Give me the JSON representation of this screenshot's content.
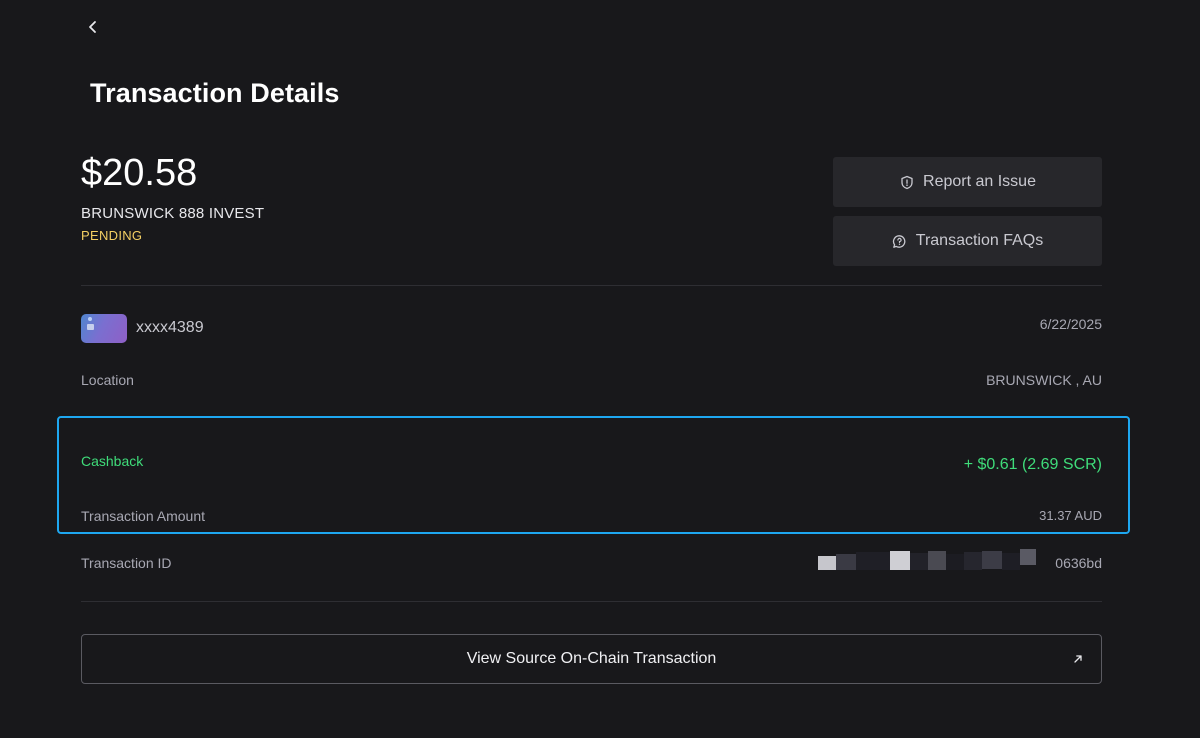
{
  "header": {
    "back_icon": "chevron-left-icon",
    "title": "Transaction Details"
  },
  "summary": {
    "amount": "$20.58",
    "merchant": "BRUNSWICK 888 INVEST",
    "status": "PENDING",
    "status_color": "#f3cf63"
  },
  "actions": {
    "report_label": "Report an Issue",
    "report_icon": "shield-icon",
    "faq_label": "Transaction FAQs",
    "faq_icon": "chat-help-icon"
  },
  "card": {
    "icon": "card-icon",
    "number": "xxxx4389",
    "date": "6/22/2025"
  },
  "details": {
    "location_label": "Location",
    "location_value": "BRUNSWICK , AU",
    "cashback_label": "Cashback",
    "cashback_value": "+ $0.61 (2.69 SCR)",
    "cashback_color": "#3fdc7a",
    "amount_label": "Transaction Amount",
    "amount_value": "31.37 AUD",
    "txid_label": "Transaction ID",
    "txid_value": "0636bd"
  },
  "footer": {
    "chain_button_label": "View Source On-Chain Transaction",
    "chain_button_icon": "external-link-icon"
  },
  "colors": {
    "background": "#18181b",
    "highlight_border": "#1ea7f0"
  }
}
